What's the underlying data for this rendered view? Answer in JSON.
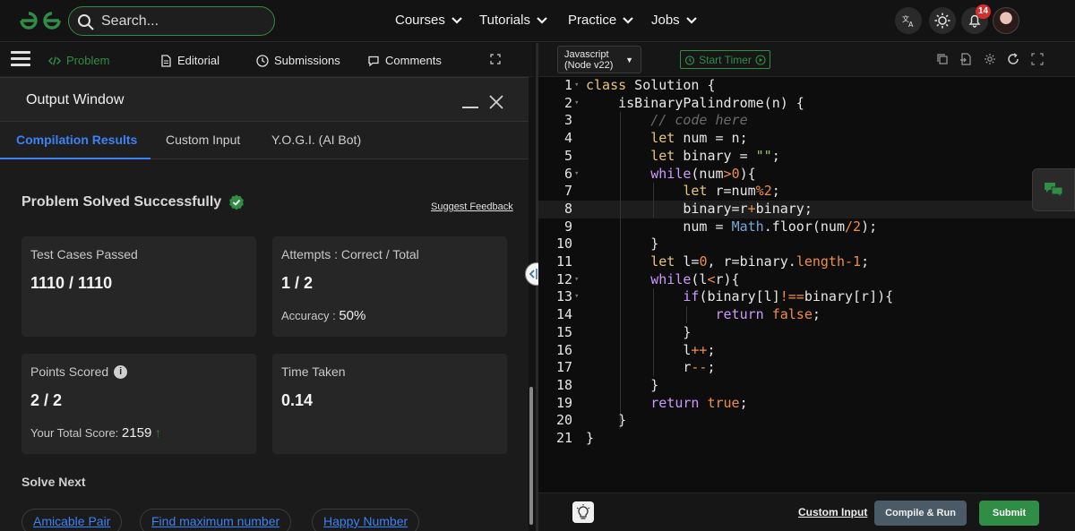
{
  "header": {
    "search_placeholder": "Search...",
    "nav": [
      "Courses",
      "Tutorials",
      "Practice",
      "Jobs"
    ],
    "notification_count": "14",
    "brand_color": "#2f8d46"
  },
  "left_tabs": {
    "problem": "Problem",
    "editorial": "Editorial",
    "submissions": "Submissions",
    "comments": "Comments"
  },
  "output": {
    "title": "Output Window",
    "tabs": [
      "Compilation Results",
      "Custom Input",
      "Y.O.G.I. (AI Bot)"
    ],
    "status": "Problem Solved Successfully",
    "suggest_feedback": "Suggest Feedback",
    "test_cases_label": "Test Cases Passed",
    "test_cases_value": "1110 / 1110",
    "attempts_label": "Attempts : Correct / Total",
    "attempts_value": "1 / 2",
    "accuracy_label": "Accuracy :",
    "accuracy_value": "50%",
    "points_label": "Points Scored",
    "points_value": "2 / 2",
    "total_score_label": "Your Total Score:",
    "total_score_value": "2159",
    "time_label": "Time Taken",
    "time_value": "0.14",
    "solve_next_label": "Solve Next",
    "solve_next": [
      "Amicable Pair",
      "Find maximum number",
      "Happy Number"
    ]
  },
  "editor": {
    "language": [
      "Javascript",
      "(Node v22)"
    ],
    "start_timer": "Start Timer",
    "custom_input": "Custom Input",
    "compile_run": "Compile & Run",
    "submit": "Submit"
  }
}
